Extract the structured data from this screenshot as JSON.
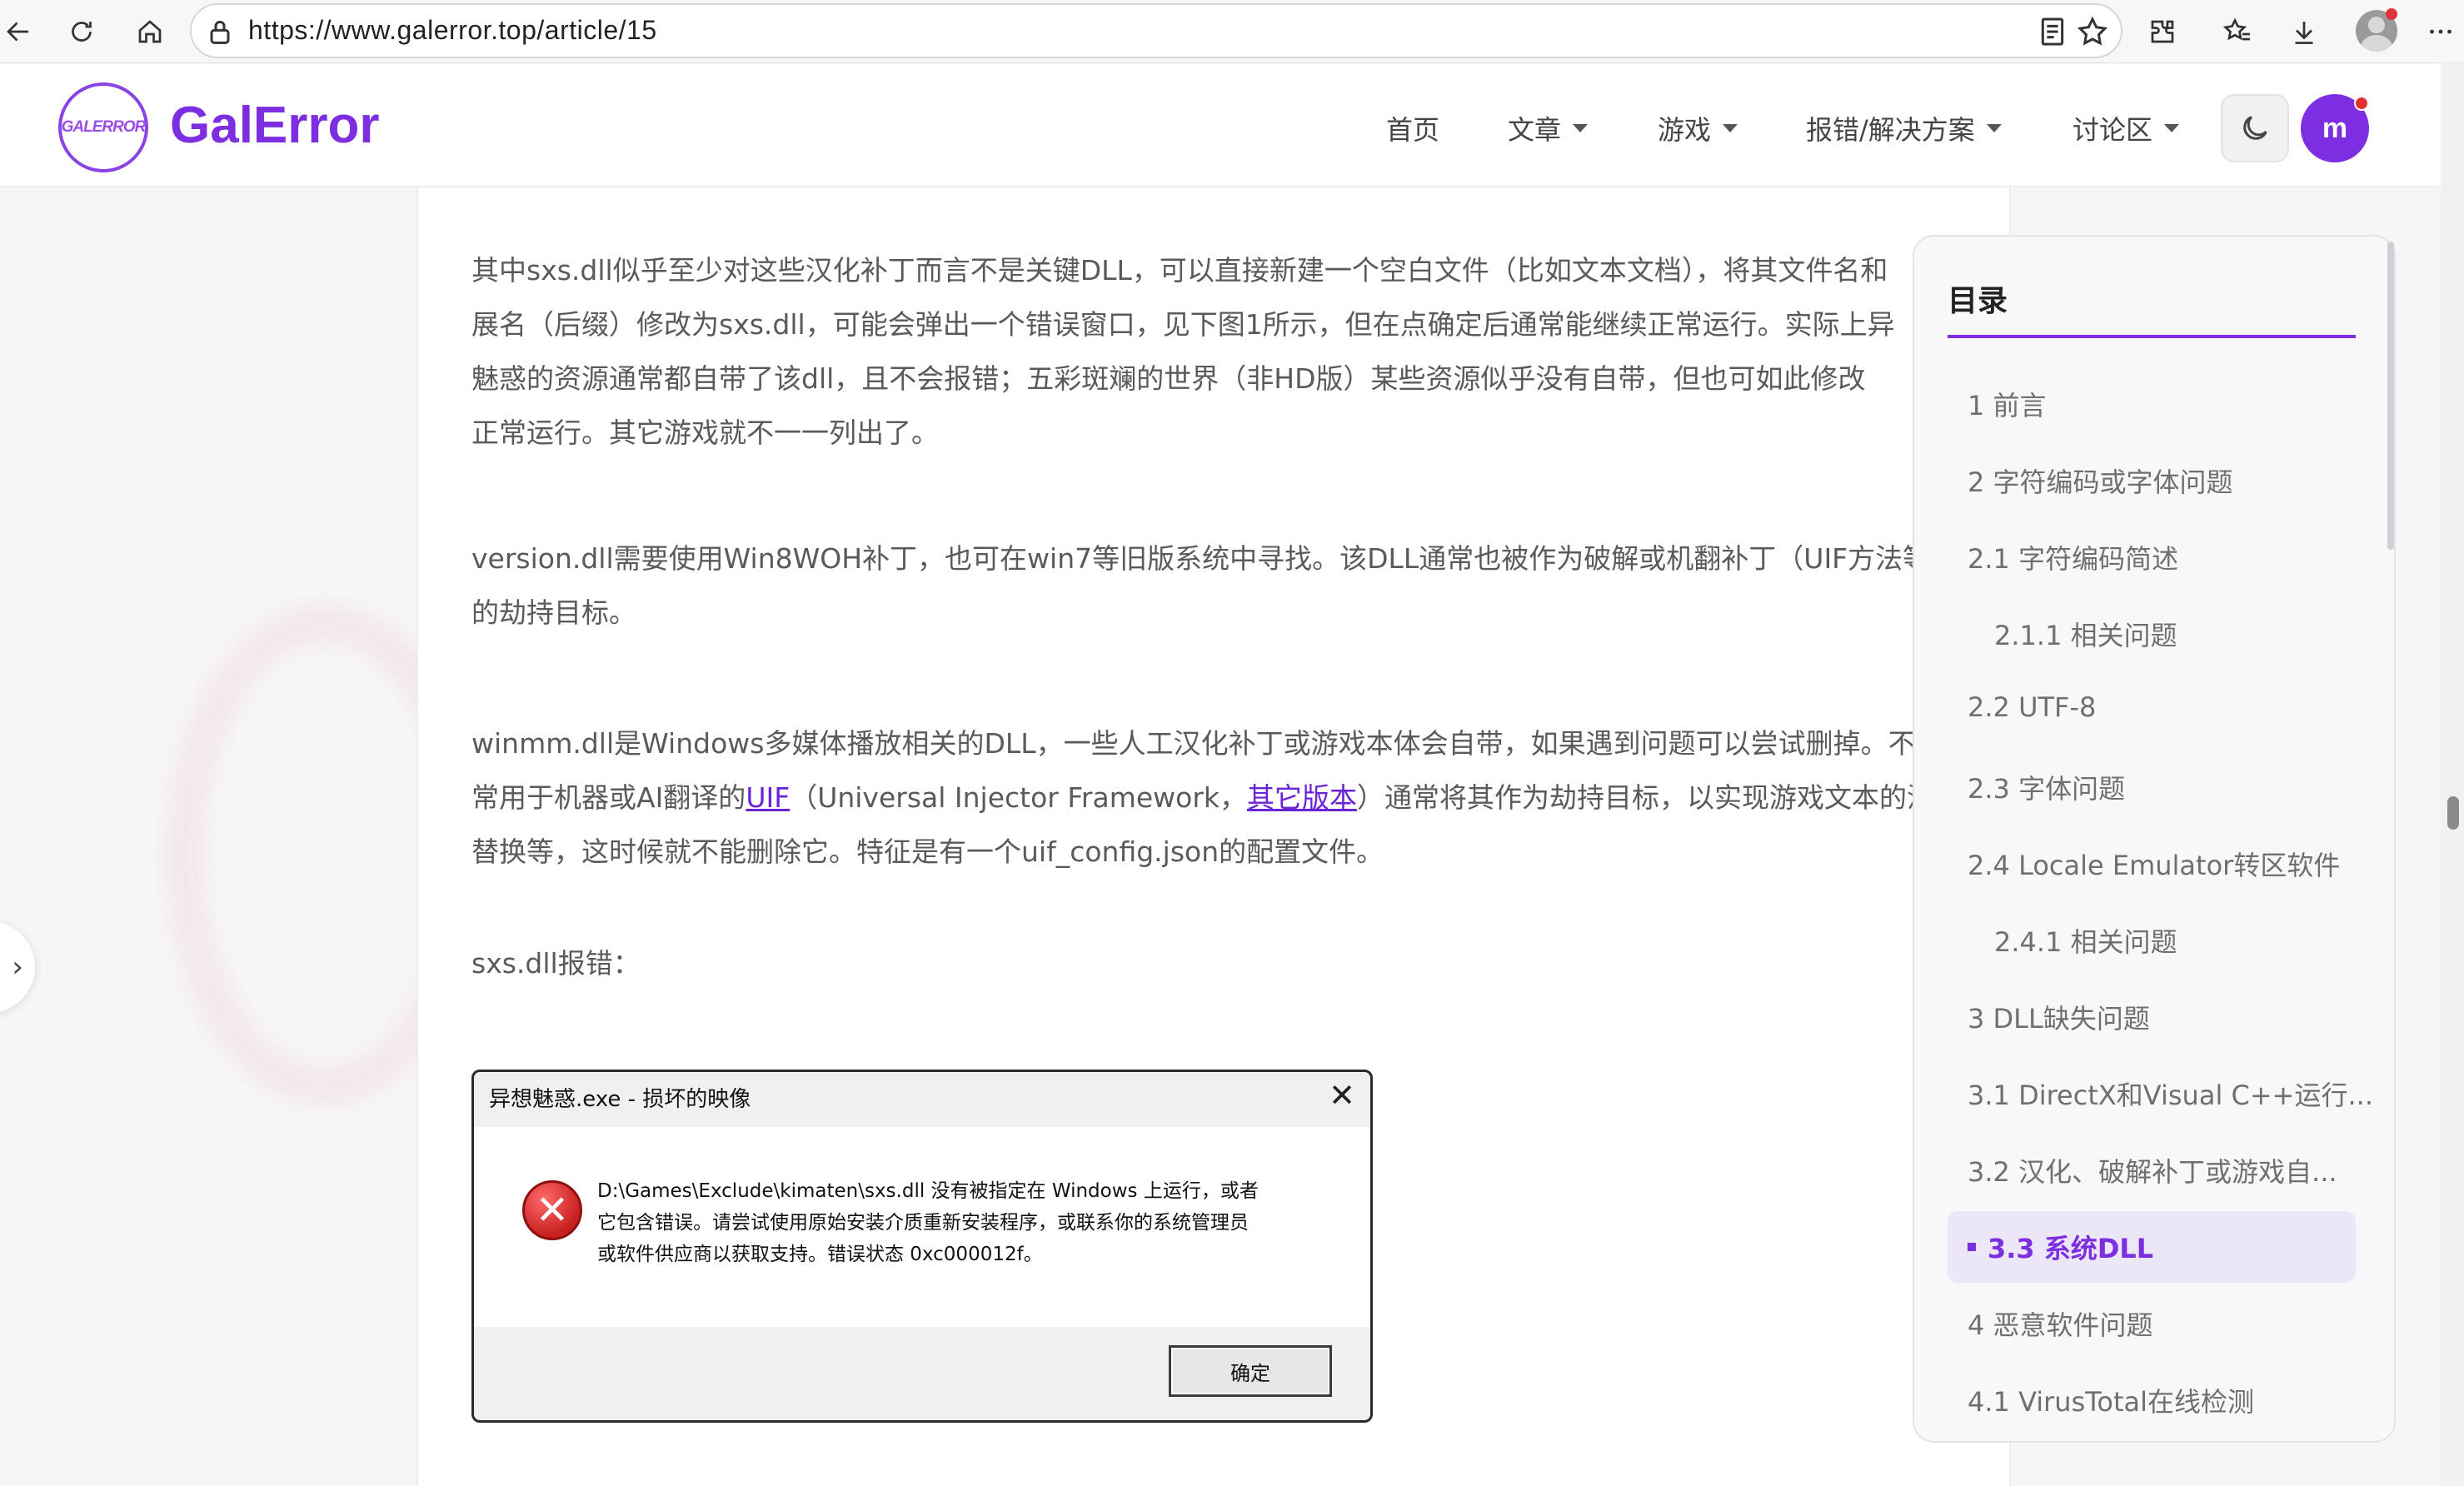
{
  "browser": {
    "url": "https://www.galerror.top/article/15"
  },
  "header": {
    "logo_text": "GALERROR",
    "brand": "GalError",
    "nav": [
      {
        "label": "首页",
        "dropdown": false
      },
      {
        "label": "文章",
        "dropdown": true
      },
      {
        "label": "游戏",
        "dropdown": true
      },
      {
        "label": "报错/解决方案",
        "dropdown": true
      },
      {
        "label": "讨论区",
        "dropdown": true
      }
    ],
    "user_initial": "m"
  },
  "article": {
    "p1": [
      "其中sxs.dll似乎至少对这些汉化补丁而言不是关键DLL，可以直接新建一个空白文件（比如文本文档），将其文件名和",
      "展名（后缀）修改为sxs.dll，可能会弹出一个错误窗口，见下图1所示，但在点确定后通常能继续正常运行。实际上异",
      "魅惑的资源通常都自带了该dll，且不会报错；五彩斑斓的世界（非HD版）某些资源似乎没有自带，但也可如此修改",
      "正常运行。其它游戏就不一一列出了。"
    ],
    "p2": [
      "version.dll需要使用Win8WOH补丁，也可在win7等旧版系统中寻找。该DLL通常也被作为破解或机翻补丁（UIF方法等",
      "的劫持目标。"
    ],
    "p3_line1": "winmm.dll是Windows多媒体播放相关的DLL，一些人工汉化补丁或游戏本体会自带，如果遇到问题可以尝试删掉。不",
    "p3_line2_a": "常用于机器或AI翻译的",
    "p3_link1": "UIF",
    "p3_line2_b": "（Universal Injector Framework，",
    "p3_link2": "其它版本",
    "p3_line2_c": "）通常将其作为劫持目标，以实现游戏文本的汉",
    "p3_line3": "替换等，这时候就不能删除它。特征是有一个uif_config.json的配置文件。",
    "p4": "sxs.dll报错："
  },
  "dialog": {
    "title": "异想魅惑.exe - 损坏的映像",
    "close": "✕",
    "message": [
      "D:\\Games\\Exclude\\kimaten\\sxs.dll 没有被指定在 Windows 上运行，或者",
      "它包含错误。请尝试使用原始安装介质重新安装程序，或联系你的系统管理员",
      "或软件供应商以获取支持。错误状态 0xc000012f。"
    ],
    "ok": "确定"
  },
  "toc": {
    "title": "目录",
    "items": [
      {
        "label": "1  前言",
        "level": 1,
        "active": false
      },
      {
        "label": "2  字符编码或字体问题",
        "level": 1,
        "active": false
      },
      {
        "label": "2.1  字符编码简述",
        "level": 2,
        "active": false
      },
      {
        "label": "2.1.1  相关问题",
        "level": 3,
        "active": false
      },
      {
        "label": "2.2  UTF-8",
        "level": 2,
        "active": false
      },
      {
        "label": "2.3  字体问题",
        "level": 2,
        "active": false
      },
      {
        "label": "2.4  Locale Emulator转区软件",
        "level": 2,
        "active": false
      },
      {
        "label": "2.4.1  相关问题",
        "level": 3,
        "active": false
      },
      {
        "label": "3  DLL缺失问题",
        "level": 1,
        "active": false
      },
      {
        "label": "3.1  DirectX和Visual C++运行...",
        "level": 2,
        "active": false
      },
      {
        "label": "3.2  汉化、破解补丁或游戏自...",
        "level": 2,
        "active": false
      },
      {
        "label": "3.3  系统DLL",
        "level": 2,
        "active": true
      },
      {
        "label": "4  恶意软件问题",
        "level": 1,
        "active": false
      },
      {
        "label": "4.1  VirusTotal在线检测",
        "level": 2,
        "active": false
      }
    ]
  },
  "colors": {
    "accent": "#7c2ee0",
    "link": "#6a24d8"
  }
}
